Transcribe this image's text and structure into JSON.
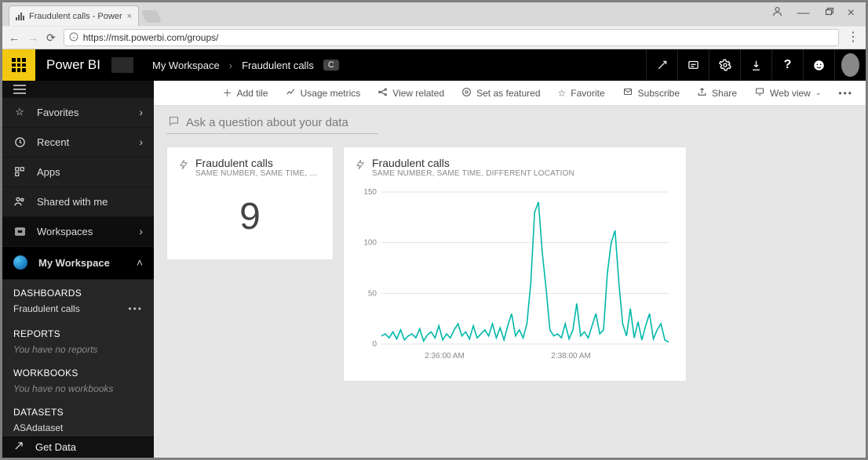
{
  "browser": {
    "tab_title": "Fraudulent calls - Power",
    "url": "https://msit.powerbi.com/groups/"
  },
  "header": {
    "brand": "Power BI",
    "breadcrumb1": "My Workspace",
    "breadcrumb2": "Fraudulent calls",
    "badge": "C"
  },
  "sidebar": {
    "favorites": "Favorites",
    "recent": "Recent",
    "apps": "Apps",
    "shared": "Shared with me",
    "workspaces": "Workspaces",
    "my_workspace": "My Workspace",
    "dashboards_hdr": "DASHBOARDS",
    "dashboard_item": "Fraudulent calls",
    "reports_hdr": "REPORTS",
    "reports_empty": "You have no reports",
    "workbooks_hdr": "WORKBOOKS",
    "workbooks_empty": "You have no workbooks",
    "datasets_hdr": "DATASETS",
    "dataset_item": "ASAdataset",
    "get_data": "Get Data"
  },
  "toolbar": {
    "add_tile": "Add tile",
    "usage": "Usage metrics",
    "related": "View related",
    "featured": "Set as featured",
    "favorite": "Favorite",
    "subscribe": "Subscribe",
    "share": "Share",
    "webview": "Web view"
  },
  "qna": {
    "placeholder": "Ask a question about your data"
  },
  "tile_small": {
    "title": "Fraudulent calls",
    "subtitle": "SAME NUMBER, SAME TIME, DIFFER...",
    "value": "9"
  },
  "tile_big": {
    "title": "Fraudulent calls",
    "subtitle": "SAME NUMBER, SAME TIME, DIFFERENT LOCATION"
  },
  "chart_data": {
    "type": "line",
    "title": "Fraudulent calls",
    "xlabel": "",
    "ylabel": "",
    "ylim": [
      0,
      150
    ],
    "yticks": [
      0,
      50,
      100,
      150
    ],
    "x_tick_labels": [
      "2:36:00 AM",
      "2:38:00 AM"
    ],
    "x": [
      0,
      1,
      2,
      3,
      4,
      5,
      6,
      7,
      8,
      9,
      10,
      11,
      12,
      13,
      14,
      15,
      16,
      17,
      18,
      19,
      20,
      21,
      22,
      23,
      24,
      25,
      26,
      27,
      28,
      29,
      30,
      31,
      32,
      33,
      34,
      35,
      36,
      37,
      38,
      39,
      40,
      41,
      42,
      43,
      44,
      45,
      46,
      47,
      48,
      49,
      50,
      51,
      52,
      53,
      54,
      55,
      56,
      57,
      58,
      59,
      60,
      61,
      62,
      63,
      64,
      65,
      66,
      67,
      68,
      69,
      70,
      71,
      72,
      73,
      74,
      75
    ],
    "values": [
      8,
      10,
      6,
      12,
      5,
      14,
      4,
      8,
      10,
      6,
      15,
      3,
      9,
      12,
      6,
      18,
      4,
      10,
      6,
      14,
      20,
      8,
      12,
      5,
      18,
      6,
      10,
      14,
      8,
      20,
      6,
      16,
      4,
      18,
      30,
      8,
      14,
      6,
      20,
      60,
      130,
      140,
      90,
      55,
      14,
      8,
      10,
      6,
      20,
      5,
      14,
      40,
      8,
      12,
      6,
      18,
      30,
      10,
      14,
      70,
      100,
      112,
      60,
      20,
      8,
      35,
      6,
      22,
      4,
      18,
      30,
      5,
      14,
      20,
      4,
      2
    ],
    "color": "#01B8AA"
  }
}
